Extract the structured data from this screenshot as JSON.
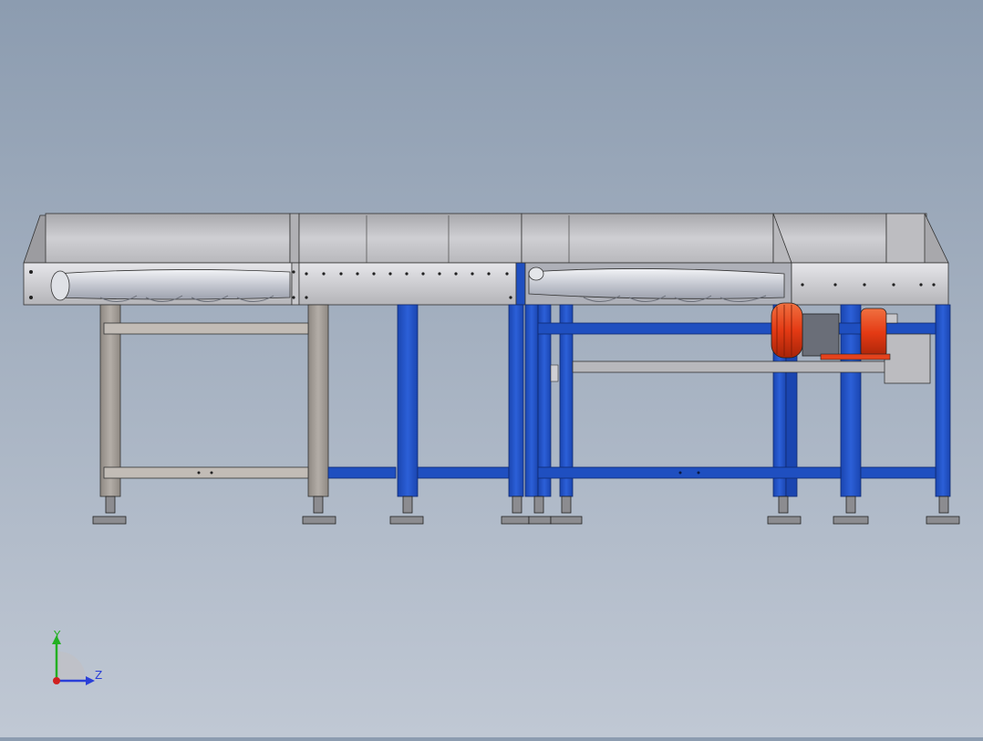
{
  "viewport": {
    "background_top": "#8c9cb0",
    "background_bottom": "#c0c8d4"
  },
  "model": {
    "colors": {
      "steel": "#c4c4c8",
      "steel_dark": "#8a8a8e",
      "frame_gray": "#a09a94",
      "frame_blue": "#1f4fc0",
      "frame_blue_dark": "#123a96",
      "motor_red": "#e8421c",
      "roller": "#d4d6dc"
    },
    "icons": [
      "triad-icon",
      "motor-icon",
      "roller-icon"
    ]
  },
  "triad": {
    "y_label": "Y",
    "z_label": "Z",
    "y_color": "#22b022",
    "z_color": "#2a3fd8",
    "x_color": "#d02020"
  }
}
